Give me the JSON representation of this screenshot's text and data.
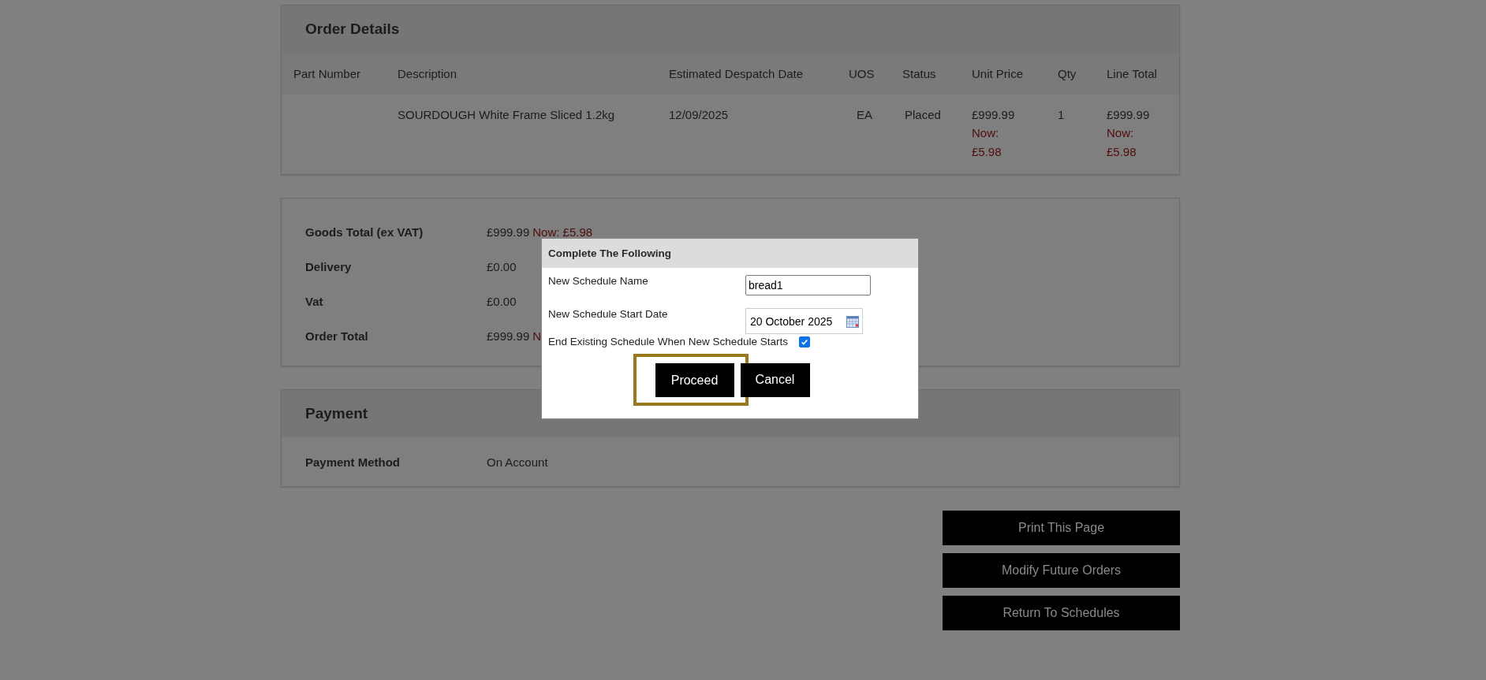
{
  "order_details": {
    "title": "Order Details",
    "columns": [
      "Part Number",
      "Description",
      "Estimated Despatch Date",
      "UOS",
      "Status",
      "Unit Price",
      "Qty",
      "Line Total"
    ],
    "rows": [
      {
        "part_number": "",
        "description": "SOURDOUGH White Frame Sliced 1.2kg",
        "despatch_date": "12/09/2025",
        "uos": "EA",
        "status": "Placed",
        "unit_price": "£999.99",
        "unit_price_now": "Now: £5.98",
        "qty": "1",
        "line_total": "£999.99",
        "line_total_now": "Now: £5.98"
      }
    ]
  },
  "totals": [
    {
      "label": "Goods Total (ex VAT)",
      "value": "£999.99",
      "now": "Now: £5.98"
    },
    {
      "label": "Delivery",
      "value": "£0.00"
    },
    {
      "label": "Vat",
      "value": "£0.00"
    },
    {
      "label": "Order Total",
      "value": "£999.99",
      "now": "N"
    }
  ],
  "payment": {
    "title": "Payment",
    "rows": [
      {
        "label": "Payment Method",
        "value": "On Account"
      }
    ]
  },
  "actions": [
    "Print This Page",
    "Modify Future Orders",
    "Return To Schedules"
  ],
  "dialog": {
    "title": "Complete The Following",
    "name_label": "New Schedule Name",
    "name_value": "bread1",
    "date_label": "New Schedule Start Date",
    "date_value": "20 October 2025",
    "end_label": "End Existing Schedule When New Schedule Starts",
    "end_checked": true,
    "buttons": [
      {
        "label": "Proceed",
        "highlighted": true
      },
      {
        "label": "Cancel",
        "highlighted": false
      }
    ]
  }
}
